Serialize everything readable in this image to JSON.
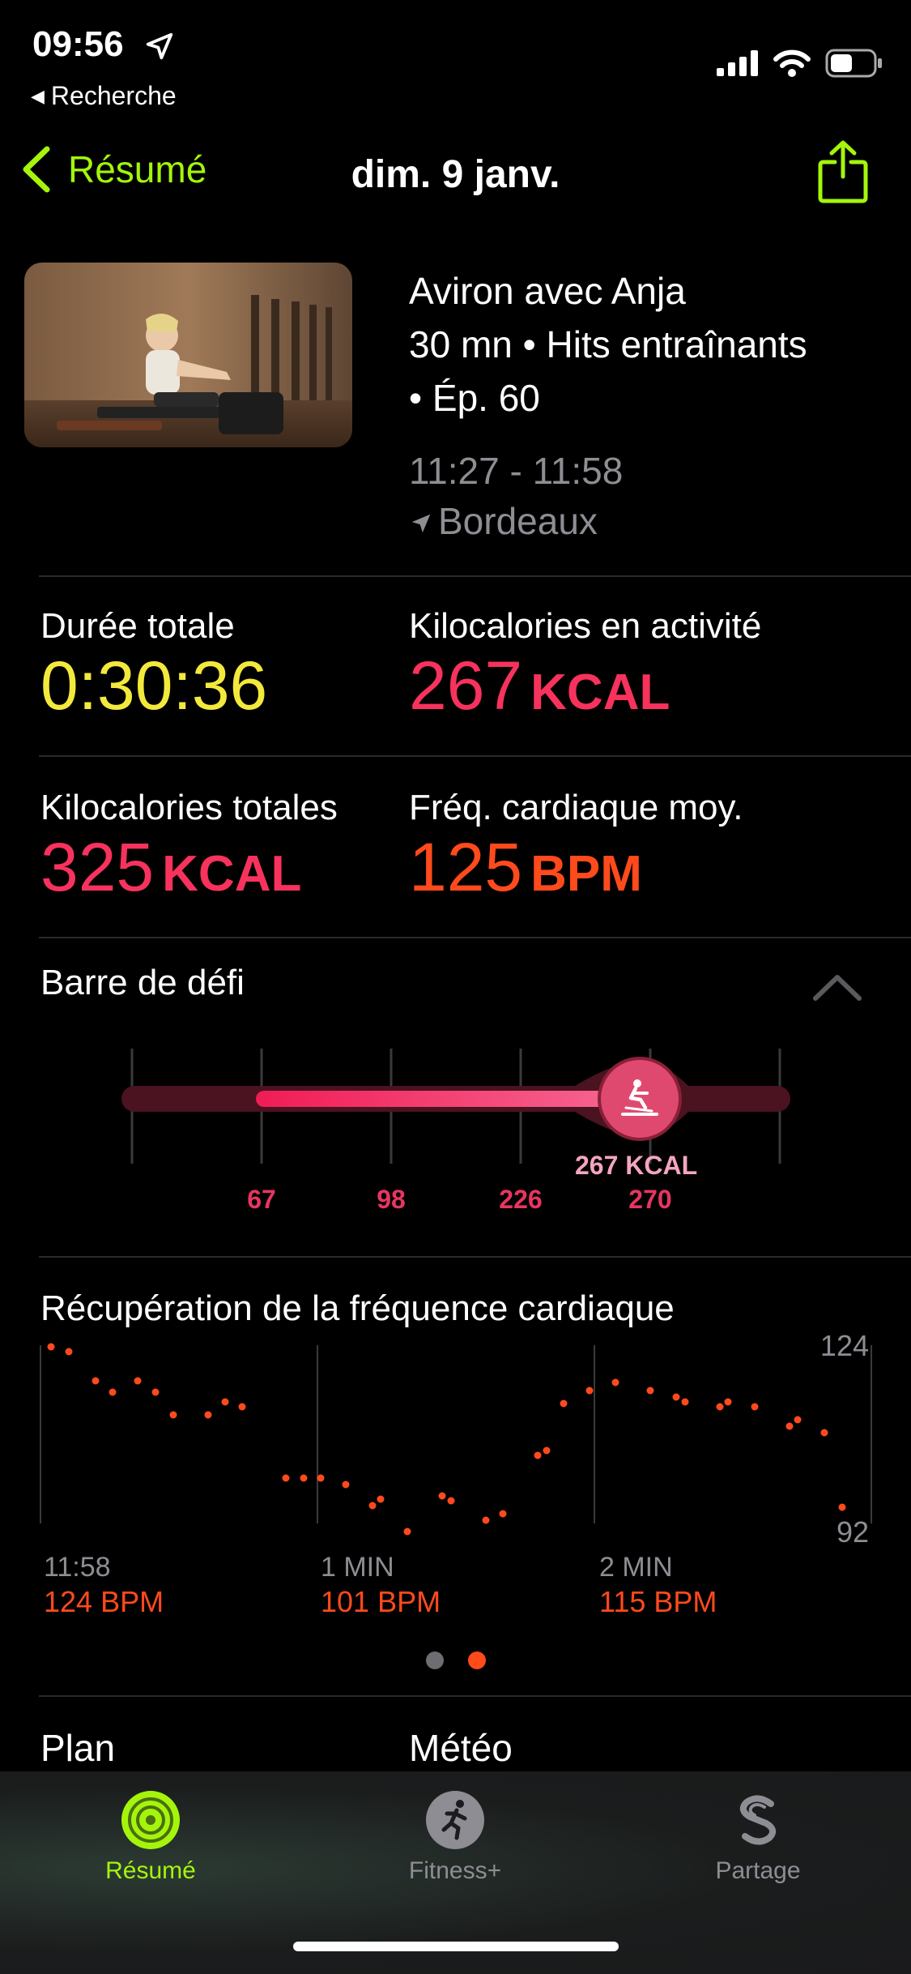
{
  "status": {
    "time": "09:56",
    "back_app": "Recherche"
  },
  "nav": {
    "back_label": "Résumé",
    "title": "dim. 9 janv."
  },
  "workout": {
    "title_line1": "Aviron avec Anja",
    "title_line2": "30 mn • Hits entraînants",
    "title_line3": "• Ép. 60",
    "time_range": "11:27 - 11:58",
    "location": "Bordeaux"
  },
  "metrics": {
    "duration": {
      "label": "Durée totale",
      "value": "0:30:36"
    },
    "active_kcal": {
      "label": "Kilocalories en activité",
      "value": "267",
      "unit": "KCAL"
    },
    "total_kcal": {
      "label": "Kilocalories totales",
      "value": "325",
      "unit": "KCAL"
    },
    "avg_hr": {
      "label": "Fréq. cardiaque moy.",
      "value": "125",
      "unit": "BPM"
    }
  },
  "challenge": {
    "title": "Barre de défi",
    "markers": [
      "67",
      "98",
      "226",
      "270"
    ],
    "current_label": "267 KCAL",
    "current_value": 267
  },
  "hr_recovery": {
    "title": "Récupération de la fréquence cardiaque",
    "y_max": "124",
    "y_min": "92",
    "x_labels": [
      "11:58",
      "1  MIN",
      "2  MIN"
    ],
    "bpm_labels": [
      "124 BPM",
      "101 BPM",
      "115 BPM"
    ]
  },
  "bottom": {
    "plan": "Plan",
    "weather": "Météo"
  },
  "tabs": [
    {
      "label": "Résumé",
      "active": true
    },
    {
      "label": "Fitness+",
      "active": false
    },
    {
      "label": "Partage",
      "active": false
    }
  ],
  "colors": {
    "accent_green": "#a4f50b",
    "duration_yellow": "#f2e93c",
    "kcal_pink": "#f7325d",
    "bpm_orange": "#ff4a1c"
  }
}
